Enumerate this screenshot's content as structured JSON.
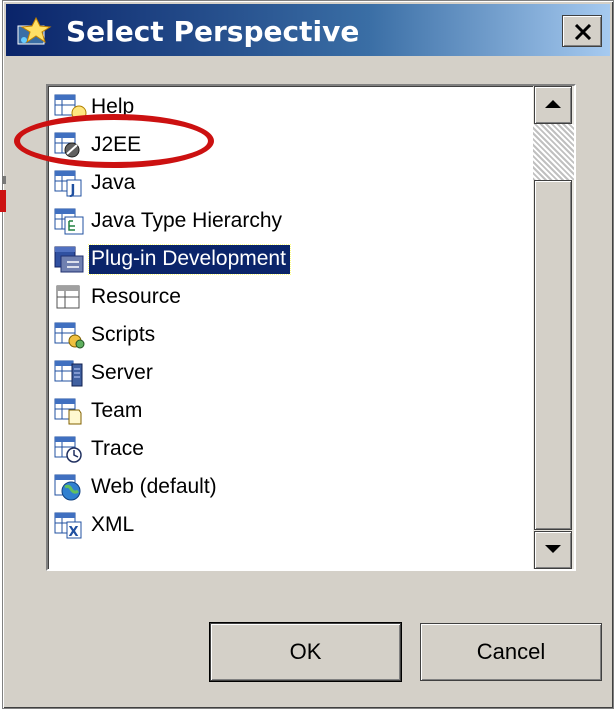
{
  "dialog": {
    "title": "Select Perspective",
    "close_label": "close-icon"
  },
  "list": {
    "items": [
      {
        "label": "Help",
        "icon": "help-perspective-icon"
      },
      {
        "label": "J2EE",
        "icon": "j2ee-perspective-icon"
      },
      {
        "label": "Java",
        "icon": "java-perspective-icon"
      },
      {
        "label": "Java Type Hierarchy",
        "icon": "java-type-hierarchy-icon"
      },
      {
        "label": "Plug-in Development",
        "icon": "plugin-development-icon",
        "selected": true
      },
      {
        "label": "Resource",
        "icon": "resource-perspective-icon"
      },
      {
        "label": "Scripts",
        "icon": "scripts-perspective-icon"
      },
      {
        "label": "Server",
        "icon": "server-perspective-icon"
      },
      {
        "label": "Team",
        "icon": "team-perspective-icon"
      },
      {
        "label": "Trace",
        "icon": "trace-perspective-icon"
      },
      {
        "label": "Web (default)",
        "icon": "web-perspective-icon"
      },
      {
        "label": "XML",
        "icon": "xml-perspective-icon"
      }
    ]
  },
  "buttons": {
    "ok": "OK",
    "cancel": "Cancel"
  },
  "colors": {
    "title_bar_start": "#0a246a",
    "title_bar_end": "#a6caf0",
    "selection": "#0a246a",
    "highlight_annotation": "#cc1111",
    "dialog_face": "#d4d0c8"
  }
}
